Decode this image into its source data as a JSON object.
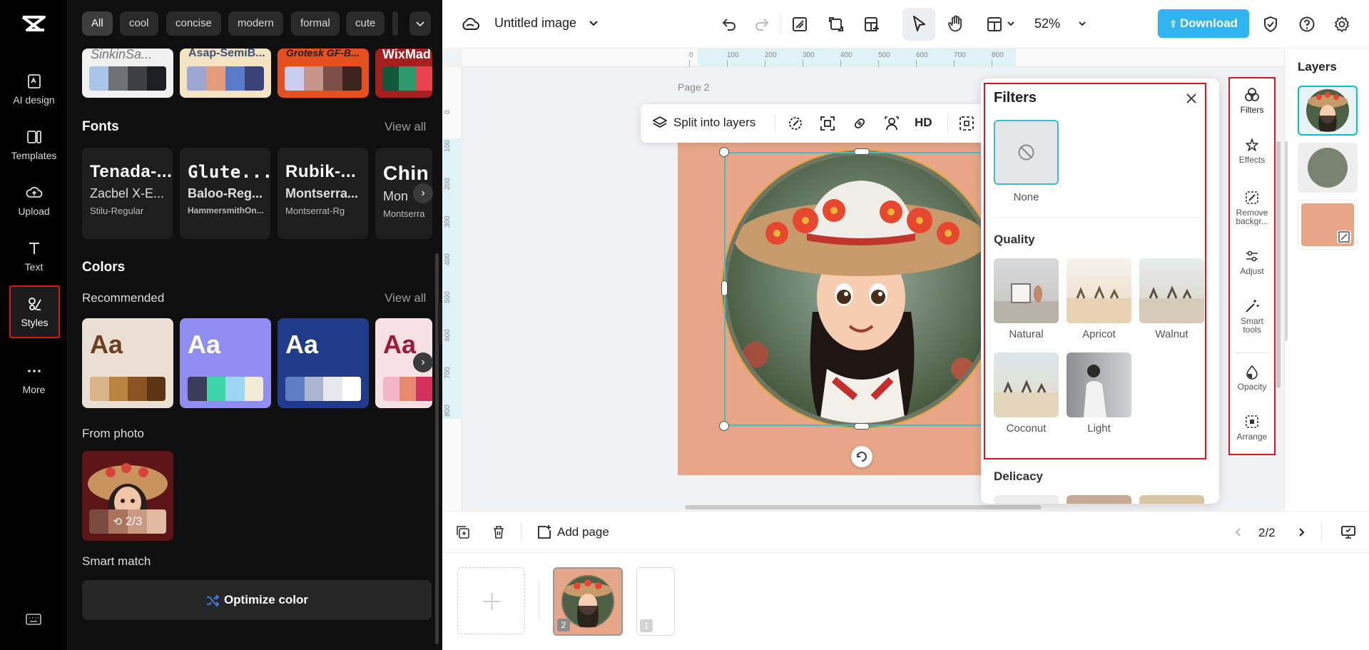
{
  "rail": {
    "items": [
      {
        "label": "AI design",
        "icon": "ai-design-icon"
      },
      {
        "label": "Templates",
        "icon": "templates-icon"
      },
      {
        "label": "Upload",
        "icon": "upload-icon"
      },
      {
        "label": "Text",
        "icon": "text-icon"
      },
      {
        "label": "Styles",
        "icon": "styles-icon"
      },
      {
        "label": "More",
        "icon": "more-icon"
      }
    ]
  },
  "styles": {
    "chips": [
      "All",
      "cool",
      "concise",
      "modern",
      "formal",
      "cute"
    ],
    "fontPreviews": [
      "SinkinSa...",
      "Asap-SemiB...",
      "Grotesk GF-B...",
      "WixMad"
    ],
    "fonts": {
      "title": "Fonts",
      "view_all": "View all",
      "cards": [
        {
          "l1": "Tenada-...",
          "l2": "Zacbel X-E...",
          "l3": "Stilu-Regular"
        },
        {
          "l1": "Glute...",
          "l2": "Baloo-Reg...",
          "l3": "HammersmithOn..."
        },
        {
          "l1": "Rubik-...",
          "l2": "Montserra...",
          "l3": "Montserrat-Rg"
        },
        {
          "l1": "Chin",
          "l2": "Mon",
          "l3": "Montserra"
        }
      ]
    },
    "colors": {
      "title": "Colors",
      "recommended": "Recommended",
      "view_all": "View all",
      "aa": "Aa"
    },
    "from_photo": {
      "title": "From photo",
      "counter": "2/3"
    },
    "smart_match": {
      "title": "Smart match",
      "button": "Optimize color"
    }
  },
  "topbar": {
    "title": "Untitled image",
    "zoom": "52%",
    "download": "Download"
  },
  "canvas": {
    "page_label": "Page 2",
    "ruler_h": [
      "0",
      "100",
      "200",
      "300",
      "400",
      "500",
      "600",
      "700",
      "800"
    ],
    "ruler_v": [
      "0",
      "100",
      "200",
      "300",
      "400",
      "500",
      "600",
      "700",
      "800"
    ],
    "toolbar": {
      "split": "Split into layers",
      "hd": "HD"
    }
  },
  "filters": {
    "title": "Filters",
    "none_label": "None",
    "quality_title": "Quality",
    "items": [
      "Natural",
      "Apricot",
      "Walnut",
      "Coconut",
      "Light"
    ],
    "delicacy_title": "Delicacy"
  },
  "tools": {
    "items": [
      {
        "label": "Filters",
        "icon": "filters-icon"
      },
      {
        "label": "Effects",
        "icon": "effects-icon"
      },
      {
        "label": "Remove backgr...",
        "icon": "remove-background-icon"
      },
      {
        "label": "Adjust",
        "icon": "adjust-icon"
      },
      {
        "label": "Smart tools",
        "icon": "smart-tools-icon"
      },
      {
        "label": "Opacity",
        "icon": "opacity-icon"
      },
      {
        "label": "Arrange",
        "icon": "arrange-icon"
      }
    ]
  },
  "layers": {
    "title": "Layers"
  },
  "bottom": {
    "add_page": "Add page",
    "page_counter": "2/2",
    "thumb_numbers": [
      "2",
      "1"
    ]
  },
  "colors": {
    "accent": "#00c4cc",
    "download": "#2fb4f0",
    "highlight_border": "#e0141e",
    "peach": "#e8a688"
  }
}
